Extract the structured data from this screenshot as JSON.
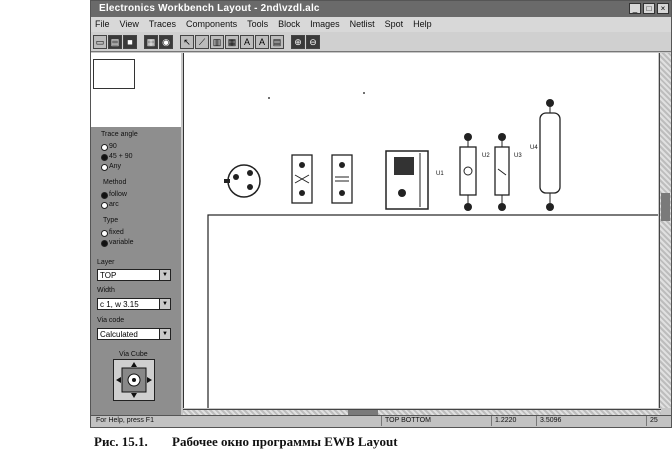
{
  "window": {
    "title": "Electronics Workbench Layout - 2nd\\vzdl.alc",
    "controls": [
      "_",
      "□",
      "×"
    ]
  },
  "menu": [
    "File",
    "View",
    "Traces",
    "Components",
    "Tools",
    "Block",
    "Images",
    "Netlist",
    "Spot",
    "Help"
  ],
  "toolbar": {
    "buttons": [
      "new-icon",
      "open-icon",
      "save-icon",
      "print-icon",
      "settings-icon",
      "select-icon",
      "trace-icon",
      "pad-icon",
      "via-icon",
      "text-icon",
      "text-box-icon",
      "grid-icon",
      "zoom-in-icon",
      "zoom-out-icon"
    ],
    "text_labels": {
      "text": "A",
      "text_box": "A"
    }
  },
  "leftpanel": {
    "trace_angle_label": "Trace angle",
    "trace_angle_options": [
      "90",
      "45 + 90",
      "Any"
    ],
    "trace_angle_selected": 1,
    "method_label": "Method",
    "method_options": [
      "follow",
      "arc"
    ],
    "method_selected": 0,
    "type_label": "Type",
    "type_options": [
      "fixed",
      "variable"
    ],
    "type_selected": 1,
    "layer_label": "Layer",
    "layer_value": "TOP",
    "width_label": "Width",
    "width_value": "c 1, w 3.15",
    "via_code_label": "Via code",
    "via_code_value": "Calculated",
    "via_cube_label": "Via Cube"
  },
  "canvas": {
    "component_labels": [
      "U1",
      "U2",
      "U3",
      "U4"
    ]
  },
  "statusbar": {
    "mode": "For Help, press F1",
    "layer": "TOP BOTTOM",
    "coord1": "1.2220",
    "coord2": "3.5096",
    "zoom": "25"
  },
  "caption": {
    "number": "Рис. 15.1.",
    "text": "Рабочее окно программы EWB Layout"
  }
}
